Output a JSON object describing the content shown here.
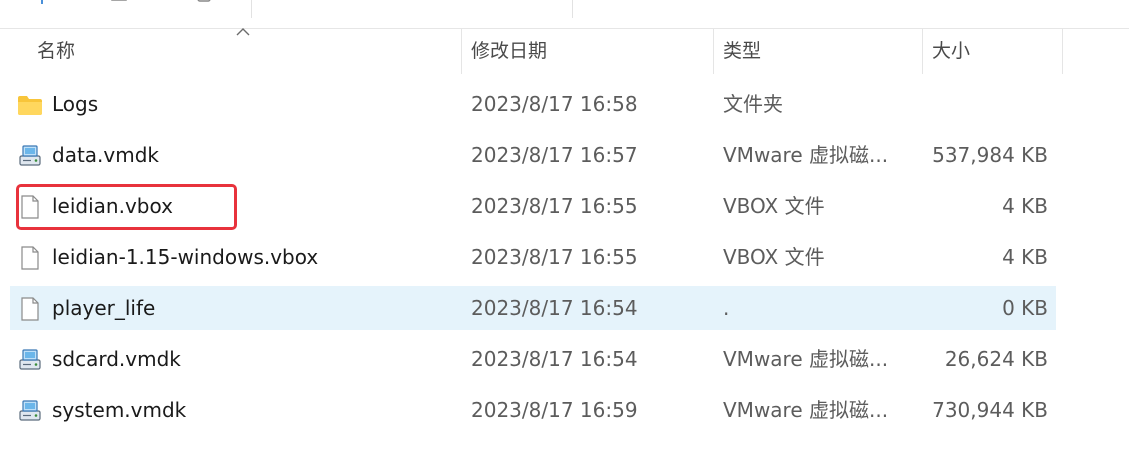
{
  "columns": {
    "name": "名称",
    "date": "修改日期",
    "type": "类型",
    "size": "大小"
  },
  "files": [
    {
      "name": "Logs",
      "date": "2023/8/17 16:58",
      "type": "文件夹",
      "size": "",
      "icon": "folder-icon",
      "hovered": false,
      "highlighted": false
    },
    {
      "name": "data.vmdk",
      "date": "2023/8/17 16:57",
      "type": "VMware 虚拟磁...",
      "size": "537,984 KB",
      "icon": "vmdk-icon",
      "hovered": false,
      "highlighted": false
    },
    {
      "name": "leidian.vbox",
      "date": "2023/8/17 16:55",
      "type": "VBOX 文件",
      "size": "4 KB",
      "icon": "file-icon",
      "hovered": false,
      "highlighted": true
    },
    {
      "name": "leidian-1.15-windows.vbox",
      "date": "2023/8/17 16:55",
      "type": "VBOX 文件",
      "size": "4 KB",
      "icon": "file-icon",
      "hovered": false,
      "highlighted": false
    },
    {
      "name": "player_life",
      "date": "2023/8/17 16:54",
      "type": ".",
      "size": "0 KB",
      "icon": "file-icon",
      "hovered": true,
      "highlighted": false
    },
    {
      "name": "sdcard.vmdk",
      "date": "2023/8/17 16:54",
      "type": "VMware 虚拟磁...",
      "size": "26,624 KB",
      "icon": "vmdk-icon",
      "hovered": false,
      "highlighted": false
    },
    {
      "name": "system.vmdk",
      "date": "2023/8/17 16:59",
      "type": "VMware 虚拟磁...",
      "size": "730,944 KB",
      "icon": "vmdk-icon",
      "hovered": false,
      "highlighted": false
    }
  ],
  "colors": {
    "hover_row": "#e5f3fb",
    "highlight_border": "#e8323c",
    "folder_yellow": "#f8c53a"
  }
}
